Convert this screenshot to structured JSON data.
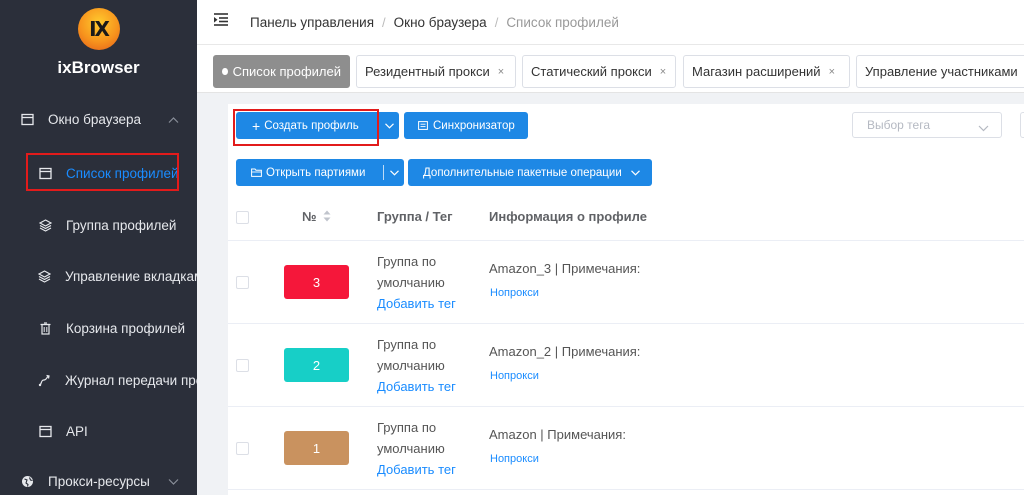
{
  "app": {
    "logo_text": "IX",
    "name": "ixBrowser"
  },
  "sidebar": {
    "browser_window": "Окно браузера",
    "items": [
      {
        "label": "Список профилей"
      },
      {
        "label": "Группа профилей"
      },
      {
        "label": "Управление вкладками"
      },
      {
        "label": "Корзина профилей"
      },
      {
        "label": "Журнал передачи профилей"
      },
      {
        "label": "API"
      }
    ],
    "proxy_resources": "Прокси-ресурсы"
  },
  "breadcrumb": {
    "item1": "Панель управления",
    "item2": "Окно браузера",
    "item3": "Список профилей",
    "sep": "/"
  },
  "tabs": [
    {
      "label": "Список профилей"
    },
    {
      "label": "Резидентный прокси"
    },
    {
      "label": "Статический прокси"
    },
    {
      "label": "Магазин расширений"
    },
    {
      "label": "Управление участниками"
    }
  ],
  "toolbar": {
    "create_profile": "Создать профиль",
    "synchronizer": "Синхронизатор",
    "tag_select_placeholder": "Выбор тега",
    "open_batch": "Открыть партиями",
    "batch_ops": "Дополнительные пакетные операции"
  },
  "table": {
    "headers": {
      "number": "№",
      "group_tag": "Группа / Тег",
      "profile_info": "Информация о профиле"
    },
    "rows": [
      {
        "number": "3",
        "color": "#f5173a",
        "group_line1": "Группа по",
        "group_line2": "умолчанию",
        "add_tag": "Добавить тег",
        "info": "Amazon_3 | Примечания:",
        "proxy": "Нопрокси"
      },
      {
        "number": "2",
        "color": "#17cfc7",
        "group_line1": "Группа по",
        "group_line2": "умолчанию",
        "add_tag": "Добавить тег",
        "info": "Amazon_2 | Примечания:",
        "proxy": "Нопрокси"
      },
      {
        "number": "1",
        "color": "#c9925f",
        "group_line1": "Группа по",
        "group_line2": "умолчанию",
        "add_tag": "Добавить тег",
        "info": "Amazon | Примечания:",
        "proxy": "Нопрокси"
      }
    ]
  },
  "colors": {
    "sidebar_bg": "#2b2f3a",
    "accent": "#1e88e5",
    "highlight": "#e21b1b"
  }
}
